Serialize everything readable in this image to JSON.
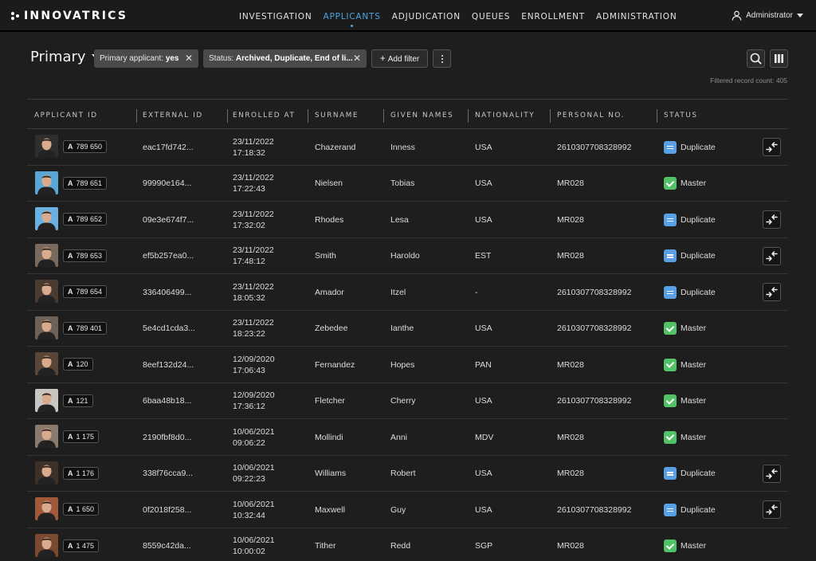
{
  "app": {
    "logo": "INNOVATRICS"
  },
  "nav": {
    "items": [
      "INVESTIGATION",
      "APPLICANTS",
      "ADJUDICATION",
      "QUEUES",
      "ENROLLMENT",
      "ADMINISTRATION"
    ],
    "active": "APPLICANTS"
  },
  "user": {
    "name": "Administrator"
  },
  "toolbar": {
    "view_title": "Primary",
    "filters": [
      {
        "label": "Primary applicant:",
        "value": "yes"
      },
      {
        "label": "Status:",
        "value": "Archived, Duplicate, End of li..."
      }
    ],
    "add_filter_label": "Add filter",
    "record_count": "Filtered record count: 405"
  },
  "table": {
    "columns": [
      "APPLICANT ID",
      "EXTERNAL ID",
      "ENROLLED AT",
      "SURNAME",
      "GIVEN NAMES",
      "NATIONALITY",
      "PERSONAL NO.",
      "STATUS"
    ],
    "rows": [
      {
        "applicant_id": "789 650",
        "external_id": "eac17fd742...",
        "date": "23/11/2022",
        "time": "17:18:32",
        "surname": "Chazerand",
        "given": "Inness",
        "nationality": "USA",
        "personal_no": "2610307708328992",
        "status": "Duplicate",
        "mergeable": true
      },
      {
        "applicant_id": "789 651",
        "external_id": "99990e164...",
        "date": "23/11/2022",
        "time": "17:22:43",
        "surname": "Nielsen",
        "given": "Tobias",
        "nationality": "USA",
        "personal_no": "MR028",
        "status": "Master",
        "mergeable": false
      },
      {
        "applicant_id": "789 652",
        "external_id": "09e3e674f7...",
        "date": "23/11/2022",
        "time": "17:32:02",
        "surname": "Rhodes",
        "given": "Lesa",
        "nationality": "USA",
        "personal_no": "MR028",
        "status": "Duplicate",
        "mergeable": true
      },
      {
        "applicant_id": "789 653",
        "external_id": "ef5b257ea0...",
        "date": "23/11/2022",
        "time": "17:48:12",
        "surname": "Smith",
        "given": "Haroldo",
        "nationality": "EST",
        "personal_no": "MR028",
        "status": "Duplicate",
        "mergeable": true
      },
      {
        "applicant_id": "789 654",
        "external_id": "336406499...",
        "date": "23/11/2022",
        "time": "18:05:32",
        "surname": "Amador",
        "given": "Itzel",
        "nationality": "-",
        "personal_no": "2610307708328992",
        "status": "Duplicate",
        "mergeable": true
      },
      {
        "applicant_id": "789 401",
        "external_id": "5e4cd1cda3...",
        "date": "23/11/2022",
        "time": "18:23:22",
        "surname": "Zebedee",
        "given": "Ianthe",
        "nationality": "USA",
        "personal_no": "2610307708328992",
        "status": "Master",
        "mergeable": false
      },
      {
        "applicant_id": "120",
        "external_id": "8eef132d24...",
        "date": "12/09/2020",
        "time": "17:06:43",
        "surname": "Fernandez",
        "given": "Hopes",
        "nationality": "PAN",
        "personal_no": "MR028",
        "status": "Master",
        "mergeable": false
      },
      {
        "applicant_id": "121",
        "external_id": "6baa48b18...",
        "date": "12/09/2020",
        "time": "17:36:12",
        "surname": "Fletcher",
        "given": "Cherry",
        "nationality": "USA",
        "personal_no": "2610307708328992",
        "status": "Master",
        "mergeable": false
      },
      {
        "applicant_id": "1 175",
        "external_id": "2190fbf8d0...",
        "date": "10/06/2021",
        "time": "09:06:22",
        "surname": "Mollindi",
        "given": "Anni",
        "nationality": "MDV",
        "personal_no": "MR028",
        "status": "Master",
        "mergeable": false
      },
      {
        "applicant_id": "1 176",
        "external_id": "338f76cca9...",
        "date": "10/06/2021",
        "time": "09:22:23",
        "surname": "Williams",
        "given": "Robert",
        "nationality": "USA",
        "personal_no": "MR028",
        "status": "Duplicate",
        "mergeable": true
      },
      {
        "applicant_id": "1 650",
        "external_id": "0f2018f258...",
        "date": "10/06/2021",
        "time": "10:32:44",
        "surname": "Maxwell",
        "given": "Guy",
        "nationality": "USA",
        "personal_no": "2610307708328992",
        "status": "Duplicate",
        "mergeable": true
      },
      {
        "applicant_id": "1 475",
        "external_id": "8559c42da...",
        "date": "10/06/2021",
        "time": "10:00:02",
        "surname": "Tither",
        "given": "Redd",
        "nationality": "SGP",
        "personal_no": "MR028",
        "status": "Master",
        "mergeable": false
      }
    ]
  },
  "colors": {
    "background": "#1e1e1f",
    "accent": "#49a5dc",
    "duplicate": "#5aa0e6",
    "master": "#52c266",
    "avatar_tones": [
      "#2e2e2e",
      "#5aa6d6",
      "#6ab0e0",
      "#7a6a5e",
      "#4a3a30",
      "#6e6258",
      "#5a4638",
      "#c9c6c2",
      "#8a7a6e",
      "#3e3128",
      "#a05a3a",
      "#7a4a30"
    ]
  },
  "icons": {
    "logo": "innovatrics-dots-icon",
    "user": "user-icon",
    "search": "search-icon",
    "columns": "columns-icon",
    "more": "more-vertical-icon",
    "merge": "merge-arrows-icon",
    "duplicate": "equals-icon",
    "master": "check-icon"
  }
}
